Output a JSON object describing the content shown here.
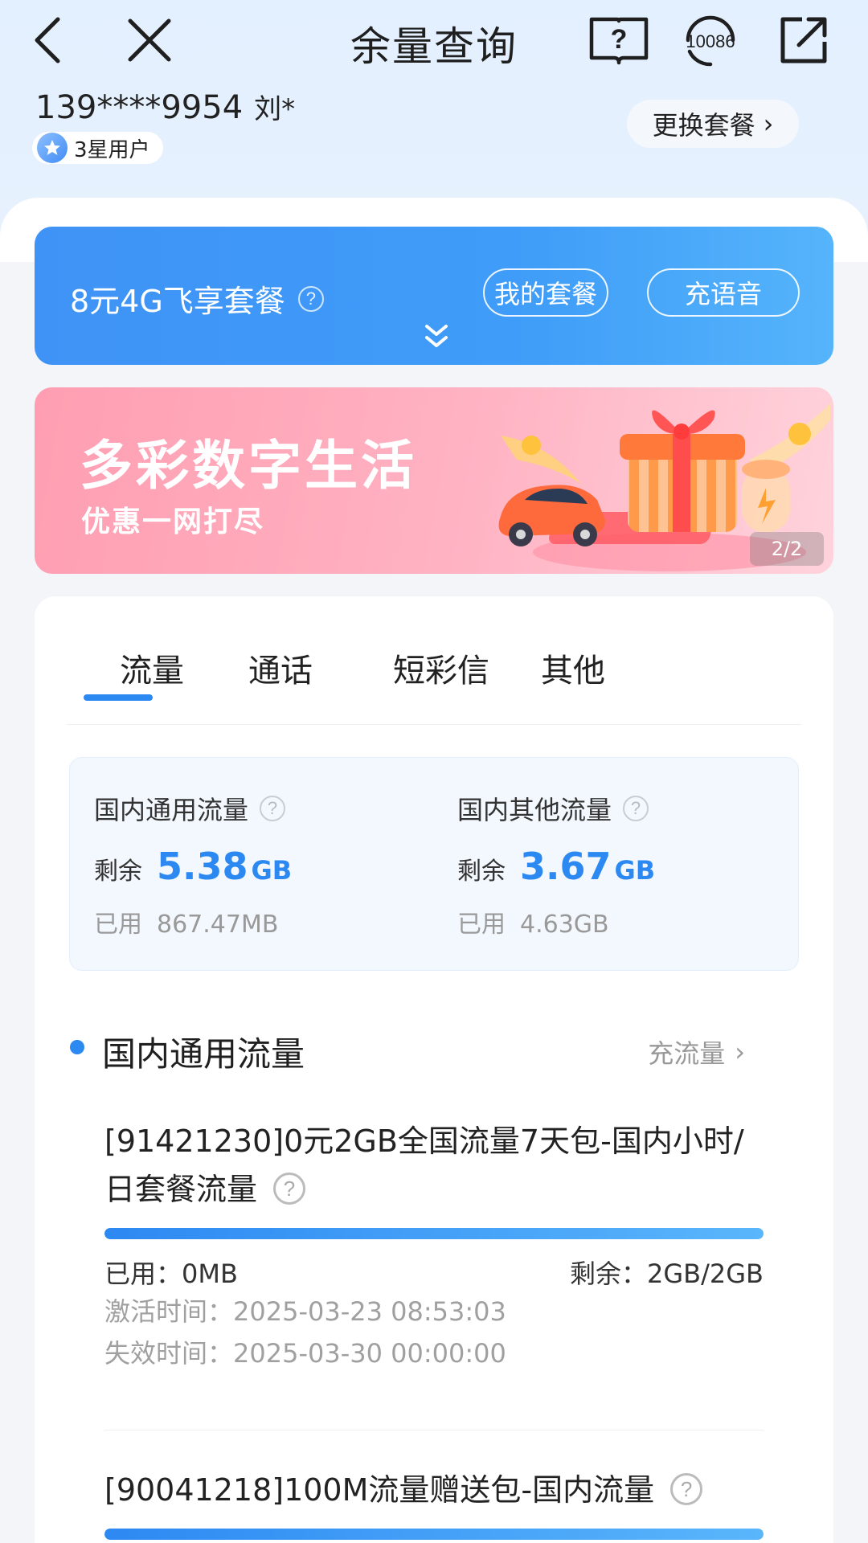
{
  "nav": {
    "title": "余量查询",
    "hotline": "10086",
    "icons": [
      "back-icon",
      "close-icon",
      "help-book-icon",
      "customer-service-icon",
      "share-icon"
    ]
  },
  "user": {
    "phone": "139****9954",
    "name": "刘*",
    "level": "3星用户",
    "change_plan_label": "更换套餐",
    "chevron": "›"
  },
  "plan": {
    "name": "8元4G飞享套餐",
    "my_plan_label": "我的套餐",
    "voice_topup_label": "充语音",
    "help_glyph": "?"
  },
  "banner": {
    "title": "多彩数字生活",
    "subtitle": "优惠一网打尽",
    "page_indicator": "2/2"
  },
  "tabs": [
    {
      "label": "流量",
      "active": true
    },
    {
      "label": "通话",
      "active": false
    },
    {
      "label": "短彩信",
      "active": false
    },
    {
      "label": "其他",
      "active": false
    }
  ],
  "summary": {
    "general": {
      "title": "国内通用流量",
      "remain_label": "剩余",
      "remain_value": "5.38",
      "remain_unit": "GB",
      "used_label": "已用",
      "used_value": "867.47MB"
    },
    "other": {
      "title": "国内其他流量",
      "remain_label": "剩余",
      "remain_value": "3.67",
      "remain_unit": "GB",
      "used_label": "已用",
      "used_value": "4.63GB"
    }
  },
  "section": {
    "title": "国内通用流量",
    "topup_label": "充流量",
    "chevron": "›"
  },
  "packages": [
    {
      "title": "[91421230]0元2GB全国流量7天包-国内小时/日套餐流量",
      "remaining_fraction": 1.0,
      "used_text": "已用：0MB",
      "remain_text": "剩余：2GB/2GB",
      "activated_text": "激活时间：2025-03-23 08:53:03",
      "expires_text": "失效时间：2025-03-30 00:00:00"
    },
    {
      "title": "[90041218]100M流量赠送包-国内流量",
      "remaining_fraction": 1.0
    }
  ],
  "colors": {
    "accent": "#2d89f2",
    "plan_card": "#3f93f6",
    "banner_pink": "#ff9eb2",
    "top_bg": "#e3f0ff"
  }
}
